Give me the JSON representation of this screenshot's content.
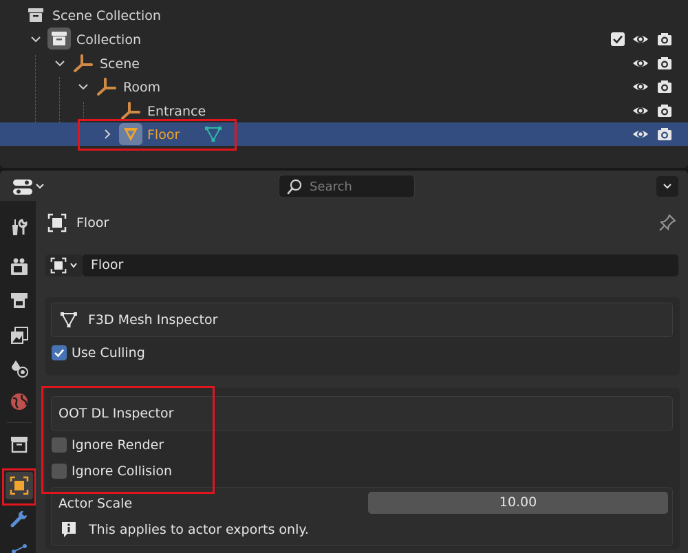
{
  "outliner": {
    "rows": [
      {
        "label": "Scene Collection"
      },
      {
        "label": "Collection"
      },
      {
        "label": "Scene"
      },
      {
        "label": "Room"
      },
      {
        "label": "Entrance"
      },
      {
        "label": "Floor"
      }
    ]
  },
  "properties": {
    "search_placeholder": "Search",
    "object_title": "Floor",
    "object_name_value": "Floor",
    "f3d_panel": {
      "title": "F3D Mesh Inspector",
      "use_culling_label": "Use Culling",
      "use_culling_checked": true
    },
    "oot_panel": {
      "title": "OOT DL Inspector",
      "ignore_render_label": "Ignore Render",
      "ignore_render_checked": false,
      "ignore_collision_label": "Ignore Collision",
      "ignore_collision_checked": false,
      "actor_scale_label": "Actor Scale",
      "actor_scale_value": "10.00",
      "info_text": "This applies to actor exports only."
    }
  },
  "colors": {
    "selection": "#334d80",
    "selected_text": "#f2a52e",
    "checkbox_on": "#4772b3",
    "highlight": "#e0151e",
    "empty_icon": "#d08a45",
    "mesh_data_icon": "#2fb7a6"
  }
}
